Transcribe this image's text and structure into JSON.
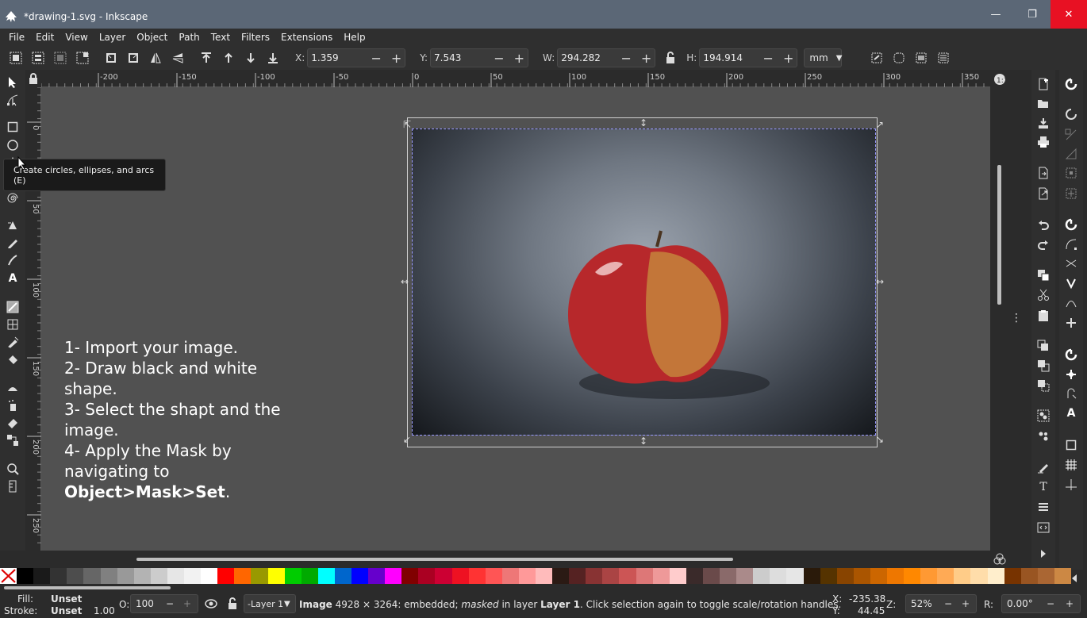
{
  "window": {
    "title": "*drawing-1.svg - Inkscape"
  },
  "menu": [
    "File",
    "Edit",
    "View",
    "Layer",
    "Object",
    "Path",
    "Text",
    "Filters",
    "Extensions",
    "Help"
  ],
  "toolbar": {
    "x_label": "X:",
    "x_value": "1.359",
    "y_label": "Y:",
    "y_value": "7.543",
    "w_label": "W:",
    "w_value": "294.282",
    "h_label": "H:",
    "h_value": "194.914",
    "unit": "mm"
  },
  "ruler": {
    "h_ticks": [
      "-200",
      "-150",
      "-100",
      "-50",
      "0",
      "50",
      "100",
      "150",
      "200",
      "250",
      "300",
      "350"
    ],
    "v_ticks": [
      "0",
      "50",
      "100",
      "150",
      "200",
      "250"
    ]
  },
  "tooltip": "Create circles, ellipses, and arcs (E)",
  "instructions": {
    "line1": "1- Import your image.",
    "line2": "2- Draw black and white\nshape.",
    "line3": "3- Select the shapt and the\nimage.",
    "line4": "4- Apply the Mask by\nnavigating to",
    "line5_bold": "Object>Mask>Set",
    "line5_rest": "."
  },
  "palette": [
    "#ffffff",
    "#000000",
    "#1a1a1a",
    "#333333",
    "#4d4d4d",
    "#666666",
    "#808080",
    "#999999",
    "#b3b3b3",
    "#cccccc",
    "#e6e6e6",
    "#f2f2f2",
    "#ffffff",
    "#ff0000",
    "#ff6600",
    "#999900",
    "#ffff00",
    "#00cc00",
    "#00aa00",
    "#00ffff",
    "#0066cc",
    "#0000ff",
    "#6600cc",
    "#ff00ff",
    "#800000",
    "#aa0022",
    "#cc0033",
    "#ee1122",
    "#ff3333",
    "#ff5555",
    "#ee7777",
    "#ff9999",
    "#ffbbbb",
    "#2b1a14",
    "#552222",
    "#883333",
    "#aa4444",
    "#cc5555",
    "#dd7777",
    "#ee9999",
    "#ffcccc",
    "#3a2a2a",
    "#6a4a4a",
    "#8a6a6a",
    "#aa8a8a",
    "#cccccc",
    "#dddddd",
    "#e6e6e6",
    "#2a1a0a",
    "#553300",
    "#884400",
    "#aa5500",
    "#cc6600",
    "#ee7700",
    "#ff8800",
    "#ff9933",
    "#ffaa55",
    "#ffcc88",
    "#ffddaa",
    "#ffeecc",
    "#773300",
    "#995522",
    "#aa6633",
    "#cc8844"
  ],
  "status": {
    "fill_label": "Fill:",
    "fill_value": "Unset",
    "stroke_label": "Stroke:",
    "stroke_value": "Unset",
    "stroke_width": "1.00",
    "opacity_label": "O:",
    "opacity_value": "100",
    "layer": "-Layer 1",
    "message_bold": "Image",
    "message_1": " 4928 × 3264: embedded; ",
    "message_italic": "masked",
    "message_2": " in layer ",
    "message_layer": "Layer 1",
    "message_3": ". Click selection again to toggle scale/rotation handles.",
    "cursor_x_label": "X:",
    "cursor_x": "-235.38",
    "cursor_y_label": "Y:",
    "cursor_y": "44.45",
    "zoom_label": "Z:",
    "zoom_value": "52%",
    "rotation_label": "R:",
    "rotation_value": "0.00°"
  }
}
